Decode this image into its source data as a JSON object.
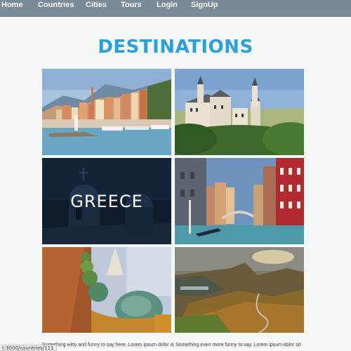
{
  "nav": {
    "items": [
      {
        "label": "Home"
      },
      {
        "label": "Countries"
      },
      {
        "label": "Cities"
      },
      {
        "label": "Tours"
      },
      {
        "label": "Login"
      },
      {
        "label": "SignUp"
      }
    ]
  },
  "page": {
    "title": "DESTINATIONS"
  },
  "tiles": [
    {
      "name": "destination-french-riviera-town"
    },
    {
      "name": "destination-castle"
    },
    {
      "name": "destination-greece",
      "overlay_label": "GREECE"
    },
    {
      "name": "destination-venice-canal"
    },
    {
      "name": "destination-gaudi-rooftop"
    },
    {
      "name": "destination-highlands-valley"
    }
  ],
  "captions": [
    "Something witty and funny to say here. Lorem ipsum dolor sit",
    "Something even more funny to say. Lorem ipsum dolor sit"
  ],
  "statusbar": {
    "url": "t:3000/countries/111"
  },
  "colors": {
    "nav_bg": "#7a8a96",
    "title": "#2aa1dc",
    "page_bg": "#f3f7f5"
  }
}
